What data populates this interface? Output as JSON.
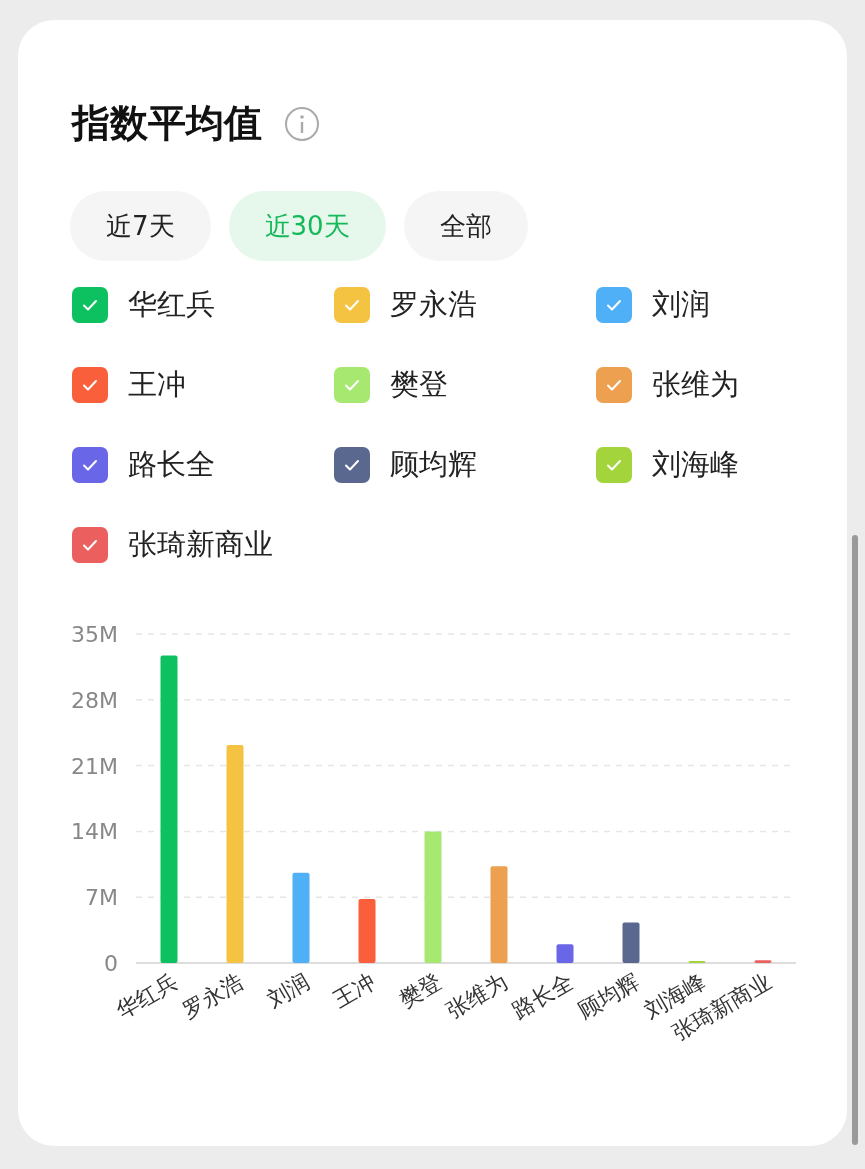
{
  "title": "指数平均值",
  "tabs": [
    {
      "label": "近7天",
      "selected": false
    },
    {
      "label": "近30天",
      "selected": true
    },
    {
      "label": "全部",
      "selected": false
    }
  ],
  "legend": [
    {
      "label": "华红兵",
      "checked": true,
      "color": "#0ec160"
    },
    {
      "label": "罗永浩",
      "checked": true,
      "color": "#f5c342"
    },
    {
      "label": "刘润",
      "checked": true,
      "color": "#4fb0f7"
    },
    {
      "label": "王冲",
      "checked": true,
      "color": "#fa5f3c"
    },
    {
      "label": "樊登",
      "checked": true,
      "color": "#a6e870"
    },
    {
      "label": "张维为",
      "checked": true,
      "color": "#eca050"
    },
    {
      "label": "路长全",
      "checked": true,
      "color": "#6a66e8"
    },
    {
      "label": "顾均辉",
      "checked": true,
      "color": "#5a6890"
    },
    {
      "label": "刘海峰",
      "checked": true,
      "color": "#a3d43c"
    },
    {
      "label": "张琦新商业",
      "checked": true,
      "color": "#eb5f5f"
    }
  ],
  "chart": {
    "chart_data": {
      "type": "bar",
      "categories": [
        "华红兵",
        "罗永浩",
        "刘润",
        "王冲",
        "樊登",
        "张维为",
        "路长全",
        "顾均辉",
        "刘海峰",
        "张琦新商业"
      ],
      "values": [
        32.7,
        23.2,
        9.6,
        6.8,
        14.0,
        10.3,
        2.0,
        4.3,
        0.2,
        0.3
      ],
      "ylim": [
        0,
        35
      ],
      "grid": true,
      "yticks": [
        {
          "value": 0,
          "label": "0"
        },
        {
          "value": 7,
          "label": "7M"
        },
        {
          "value": 14,
          "label": "14M"
        },
        {
          "value": 21,
          "label": "21M"
        },
        {
          "value": 28,
          "label": "28M"
        },
        {
          "value": 35,
          "label": "35M"
        }
      ]
    }
  }
}
